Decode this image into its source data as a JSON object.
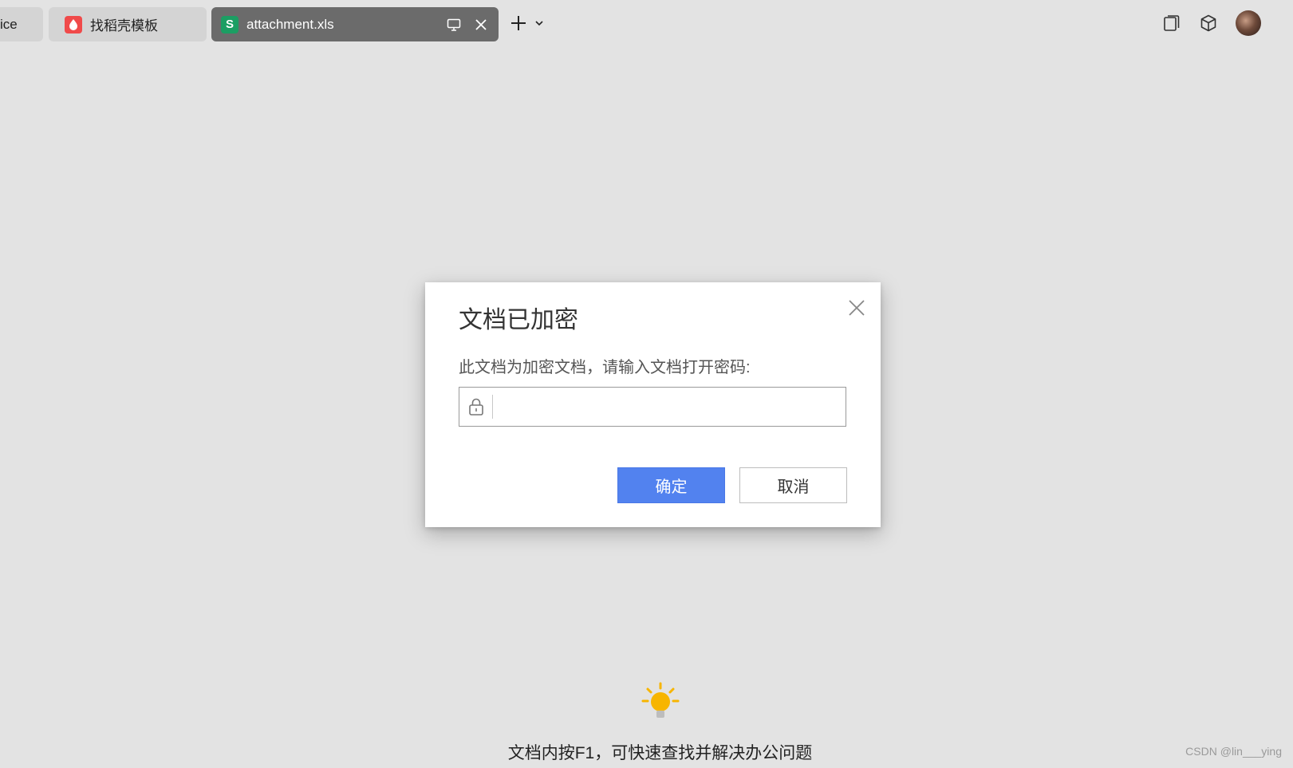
{
  "tabs": [
    {
      "label": "ice",
      "icon": null
    },
    {
      "label": "找稻壳模板",
      "icon": "docer-icon"
    },
    {
      "label": "attachment.xls",
      "icon": "spreadsheet-icon",
      "active": true
    }
  ],
  "dialog": {
    "title": "文档已加密",
    "message": "此文档为加密文档，请输入文档打开密码:",
    "password_value": "",
    "ok_label": "确定",
    "cancel_label": "取消"
  },
  "tip": {
    "text": "文档内按F1，可快速查找并解决办公问题",
    "icon": "lightbulb-icon"
  },
  "watermark": "CSDN @lin___ying",
  "colors": {
    "background": "#e3e3e3",
    "active_tab": "#6b6b6b",
    "primary_button": "#5282ef",
    "spreadsheet_green": "#1c9e63",
    "docer_red": "#f04a4a",
    "bulb_yellow": "#f7b500"
  }
}
